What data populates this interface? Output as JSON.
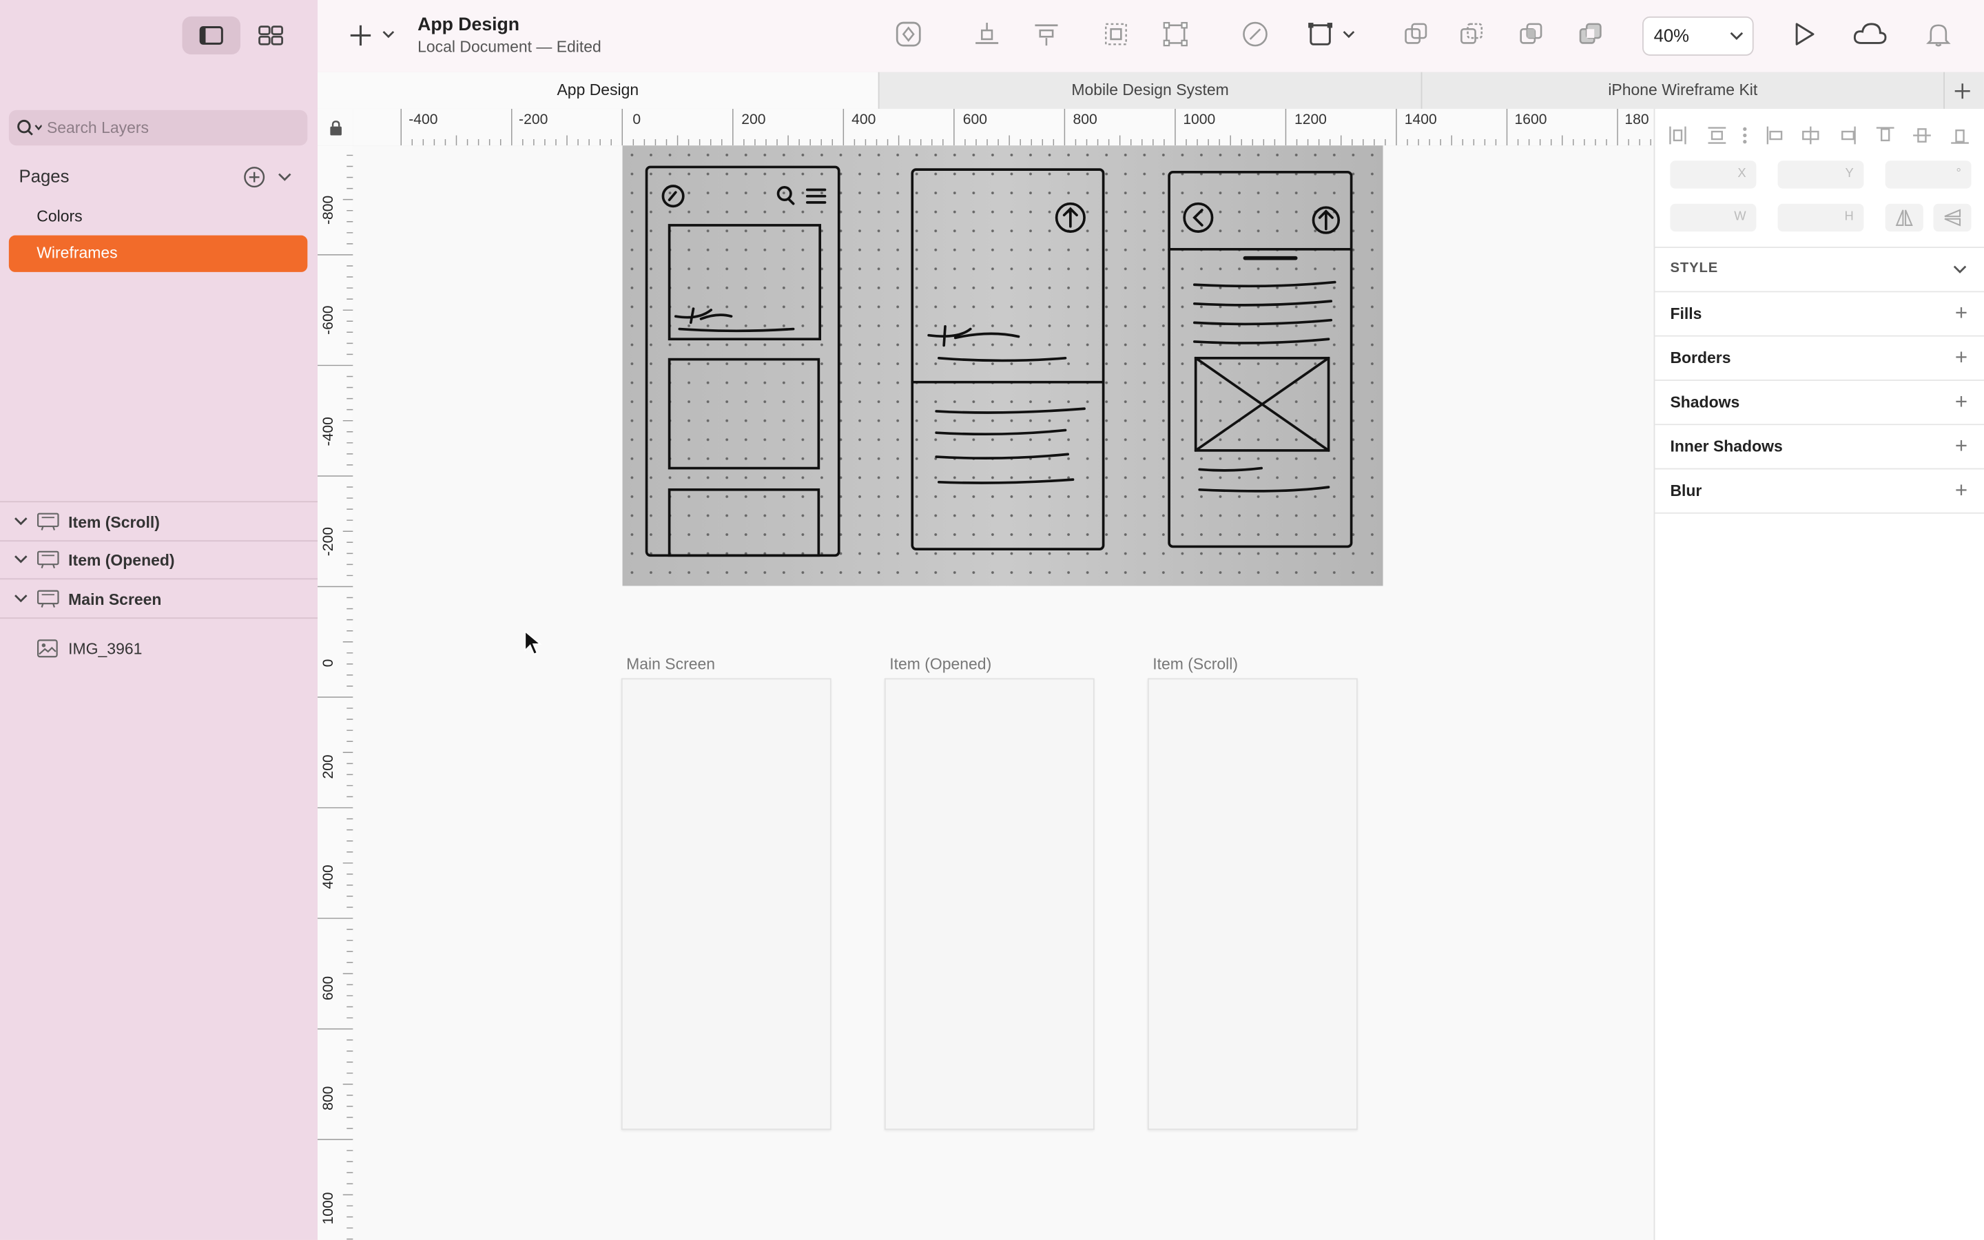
{
  "window": {
    "title": "App Design",
    "subtitle": "Local Document — Edited"
  },
  "sidebar": {
    "search_placeholder": "Search Layers",
    "pages_title": "Pages",
    "pages": [
      {
        "label": "Colors",
        "selected": false
      },
      {
        "label": "Wireframes",
        "selected": true
      }
    ],
    "layers": [
      {
        "label": "Item (Scroll)",
        "icon": "artboard-icon",
        "expanded": true
      },
      {
        "label": "Item (Opened)",
        "icon": "artboard-icon",
        "expanded": true
      },
      {
        "label": "Main Screen",
        "icon": "artboard-icon",
        "expanded": true
      },
      {
        "label": "IMG_3961",
        "icon": "image-icon"
      }
    ]
  },
  "toolbar": {
    "zoom": "40%"
  },
  "tabs": [
    {
      "label": "App Design",
      "active": true
    },
    {
      "label": "Mobile Design System",
      "active": false
    },
    {
      "label": "iPhone Wireframe Kit",
      "active": false
    }
  ],
  "rulers": {
    "horizontal": [
      "-400",
      "-200",
      "0",
      "200",
      "400",
      "600",
      "800",
      "1000",
      "1200",
      "1400",
      "1600",
      "180"
    ],
    "vertical": [
      "-800",
      "-600",
      "-400",
      "-200",
      "0",
      "200",
      "400",
      "600",
      "800",
      "1000"
    ]
  },
  "canvas": {
    "artboards": [
      {
        "label": "Main Screen"
      },
      {
        "label": "Item (Opened)"
      },
      {
        "label": "Item (Scroll)"
      }
    ],
    "sketch_text": "T"
  },
  "inspector": {
    "fields": {
      "x": "X",
      "y": "Y",
      "rotation": "°",
      "w": "W",
      "h": "H"
    },
    "style_header": "STYLE",
    "sections": [
      "Fills",
      "Borders",
      "Shadows",
      "Inner Shadows",
      "Blur"
    ]
  }
}
